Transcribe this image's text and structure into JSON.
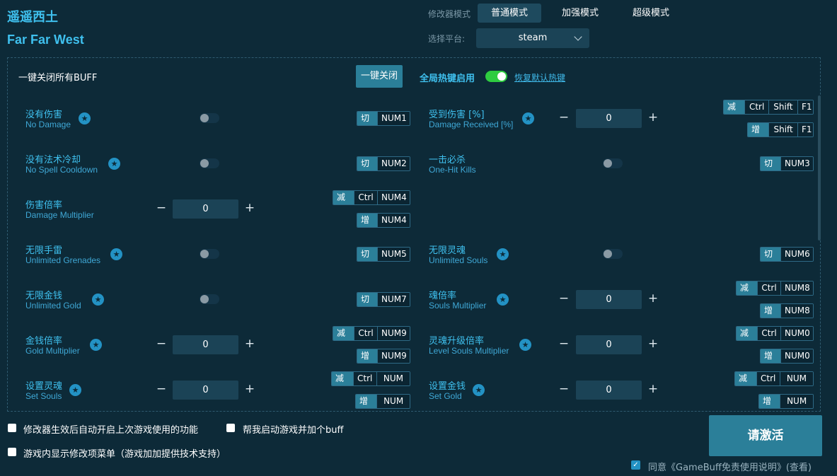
{
  "app": {
    "title_cn": "遥遥西土",
    "title_en": "Far Far West"
  },
  "modes": {
    "label": "修改器模式",
    "tabs": [
      "普通模式",
      "加强模式",
      "超级模式"
    ],
    "active": 0
  },
  "platform": {
    "label": "选择平台:",
    "value": "steam"
  },
  "toolbar": {
    "close_all_label": "一键关闭所有BUFF",
    "close_all_button": "一键关闭",
    "global_hotkey_label": "全局热键启用",
    "reset_hotkey": "恢复默认热键"
  },
  "rows": [
    {
      "cn": "没有伤害",
      "en": "No Damage",
      "type": "toggle",
      "hotkeys": [
        {
          "action": "切换",
          "keys": [
            "NUM1"
          ]
        }
      ]
    },
    {
      "cn": "受到伤害 [%]",
      "en": "Damage Received [%]",
      "type": "number",
      "value": "0",
      "hotkeys": [
        {
          "action": "减少",
          "keys": [
            "Ctrl",
            "Shift",
            "F1"
          ]
        },
        {
          "action": "增加",
          "keys": [
            "Shift",
            "F1"
          ]
        }
      ]
    },
    {
      "cn": "没有法术冷却",
      "en": "No Spell Cooldown",
      "type": "toggle",
      "hotkeys": [
        {
          "action": "切换",
          "keys": [
            "NUM2"
          ]
        }
      ]
    },
    {
      "cn": "一击必杀",
      "en": "One-Hit Kills",
      "type": "toggle",
      "hotkeys": [
        {
          "action": "切换",
          "keys": [
            "NUM3"
          ]
        }
      ]
    },
    {
      "cn": "伤害倍率",
      "en": "Damage Multiplier",
      "type": "number",
      "value": "0",
      "hotkeys": [
        {
          "action": "减少",
          "keys": [
            "Ctrl",
            "NUM4"
          ]
        },
        {
          "action": "增加",
          "keys": [
            "NUM4"
          ]
        }
      ]
    },
    {
      "cn": "无限手雷",
      "en": "Unlimited Grenades",
      "type": "toggle",
      "hotkeys": [
        {
          "action": "切换",
          "keys": [
            "NUM5"
          ]
        }
      ]
    },
    {
      "cn": "无限灵魂",
      "en": "Unlimited Souls",
      "type": "toggle",
      "hotkeys": [
        {
          "action": "切换",
          "keys": [
            "NUM6"
          ]
        }
      ]
    },
    {
      "cn": "无限金钱",
      "en": "Unlimited Gold",
      "type": "toggle",
      "hotkeys": [
        {
          "action": "切换",
          "keys": [
            "NUM7"
          ]
        }
      ]
    },
    {
      "cn": "魂倍率",
      "en": "Souls Multiplier",
      "type": "number",
      "value": "0",
      "hotkeys": [
        {
          "action": "减少",
          "keys": [
            "Ctrl",
            "NUM8"
          ]
        },
        {
          "action": "增加",
          "keys": [
            "NUM8"
          ]
        }
      ]
    },
    {
      "cn": "金钱倍率",
      "en": "Gold Multiplier",
      "type": "number",
      "value": "0",
      "hotkeys": [
        {
          "action": "减少",
          "keys": [
            "Ctrl",
            "NUM9"
          ]
        },
        {
          "action": "增加",
          "keys": [
            "NUM9"
          ]
        }
      ]
    },
    {
      "cn": "灵魂升级倍率",
      "en": "Level Souls Multiplier",
      "type": "number",
      "value": "0",
      "hotkeys": [
        {
          "action": "减少",
          "keys": [
            "Ctrl",
            "NUM0"
          ]
        },
        {
          "action": "增加",
          "keys": [
            "NUM0"
          ]
        }
      ]
    },
    {
      "cn": "设置灵魂",
      "en": "Set Souls",
      "type": "number",
      "value": "0",
      "hotkeys": [
        {
          "action": "减少",
          "keys": [
            "Ctrl",
            "NUM *"
          ]
        },
        {
          "action": "增加",
          "keys": [
            "NUM *"
          ]
        }
      ]
    },
    {
      "cn": "设置金钱",
      "en": "Set Gold",
      "type": "number",
      "value": "0",
      "hotkeys": [
        {
          "action": "减少",
          "keys": [
            "Ctrl",
            "NUM +"
          ]
        },
        {
          "action": "增加",
          "keys": [
            "NUM +"
          ]
        }
      ]
    }
  ],
  "footer": {
    "option1": "修改器生效后自动开启上次游戏使用的功能",
    "option2": "帮我启动游戏并加个buff",
    "option3": "游戏内显示修改项菜单（游戏加加提供技术支持）",
    "activate": "请激活",
    "agree": "同意《GameBuff免责使用说明》(查看)"
  }
}
